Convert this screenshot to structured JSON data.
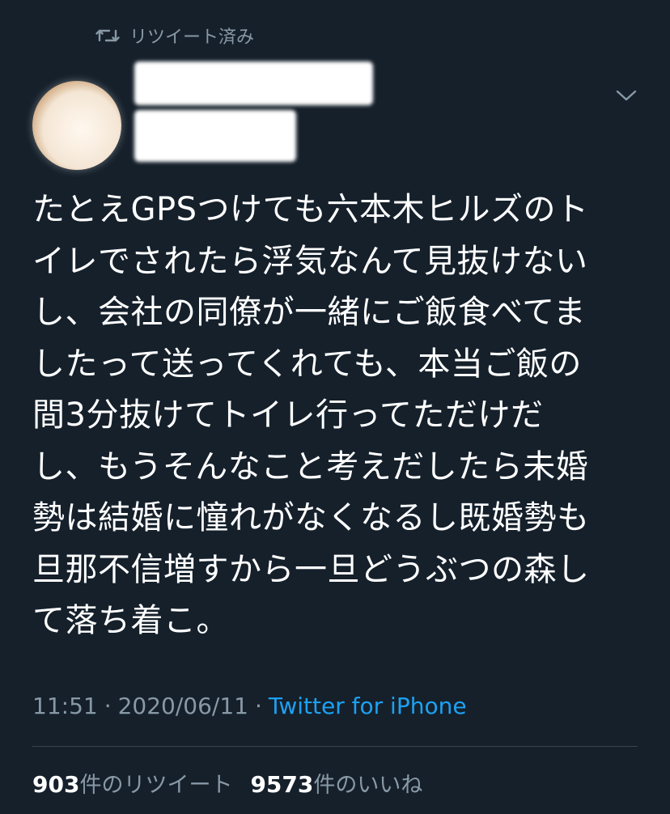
{
  "retweet": {
    "label": "リツイート済み",
    "icon": "retweet-icon"
  },
  "user": {
    "avatar_icon": "avatar",
    "menu_icon": "chevron-down-icon"
  },
  "tweet": {
    "text": "たとえGPSつけても六本木ヒルズのト\nイレでされたら浮気なんて見抜けない\nし、会社の同僚が一緒にご飯食べてま\nしたって送ってくれても、本当ご飯の\n間3分抜けてトイレ行ってただけだ\nし、もうそんなこと考えだしたら未婚\n勢は結婚に憧れがなくなるし既婚勢も\n旦那不信増すから一旦どうぶつの森し\nて落ち着こ。",
    "time": "11:51",
    "separator": "·",
    "date": "2020/06/11",
    "source": "Twitter for iPhone"
  },
  "stats": {
    "retweets_count": "903",
    "retweets_label": "件のリツイート",
    "likes_count": "9573",
    "likes_label": "件のいいね"
  },
  "colors": {
    "background": "#15202b",
    "text": "#ffffff",
    "secondary": "#8899a6",
    "link": "#1da1f2",
    "divider": "#38444d"
  }
}
